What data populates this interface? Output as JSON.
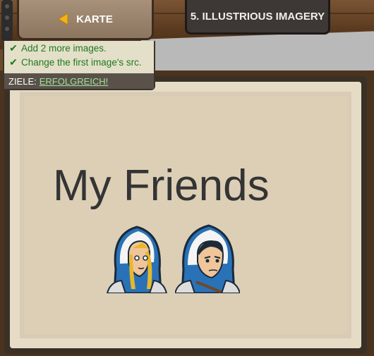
{
  "nav": {
    "back_label": "KARTE",
    "level_title": "5. ILLUSTRIOUS IMAGERY"
  },
  "goals": {
    "items": [
      {
        "label": "Add 2 more images."
      },
      {
        "label": "Change the first image's src."
      }
    ],
    "footer_label": "ZIELE:",
    "status": "ERFOLGREICH!"
  },
  "page": {
    "heading": "My Friends"
  },
  "colors": {
    "goal_green": "#1e7a1e",
    "status_green": "#9fe39a",
    "parchment": "#dccfb6"
  }
}
